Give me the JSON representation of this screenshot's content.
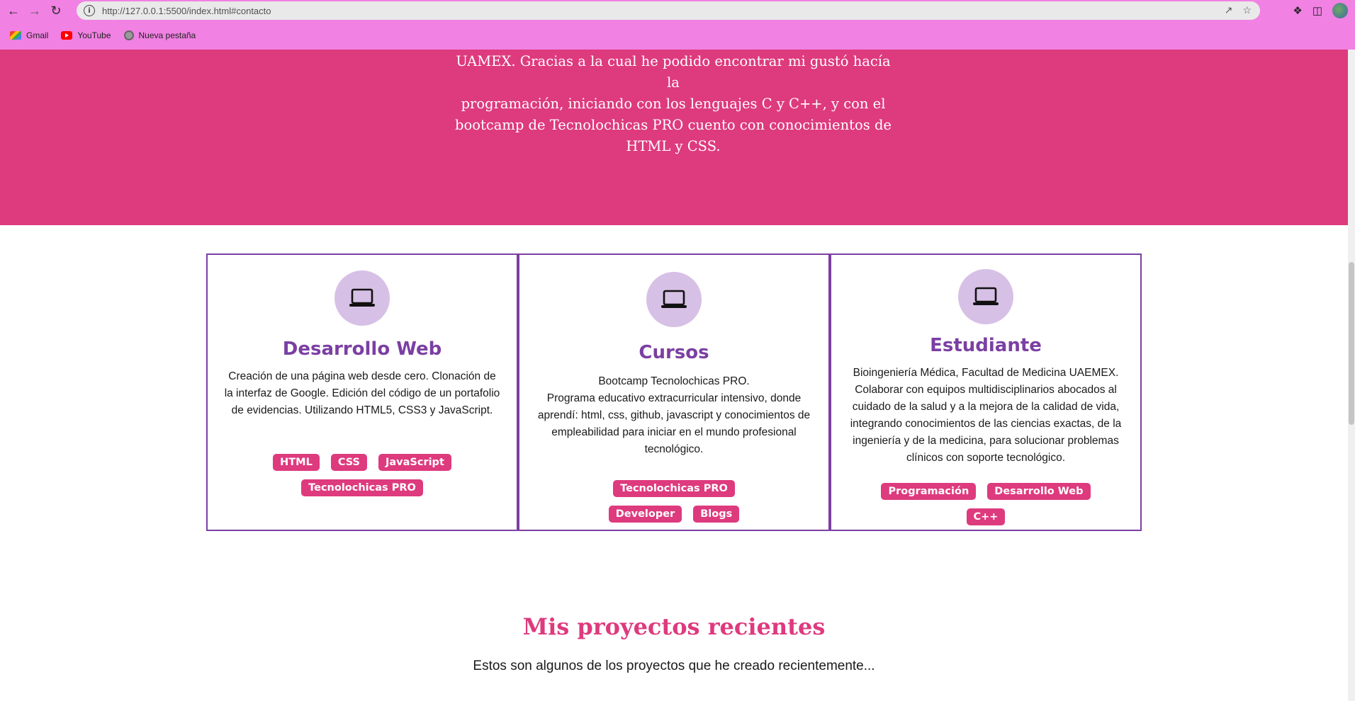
{
  "browser": {
    "url": "http://127.0.0.1:5500/index.html#contacto",
    "bookmarks": [
      {
        "label": "Gmail",
        "icon": "gmail-icon"
      },
      {
        "label": "YouTube",
        "icon": "youtube-icon"
      },
      {
        "label": "Nueva pestaña",
        "icon": "globe-icon"
      }
    ]
  },
  "hero": {
    "lines": [
      "UAMEX. Gracias a la cual he podido encontrar mi gustó hacía la",
      "programación, iniciando con los lenguajes C y C++, y con el",
      "bootcamp de Tecnolochicas PRO cuento con conocimientos de",
      "HTML y CSS."
    ]
  },
  "cards": [
    {
      "icon": "laptop-icon",
      "title": "Desarrollo Web",
      "description": "Creación de una página web desde cero. Clonación de la interfaz de Google. Edición del código de un portafolio de evidencias. Utilizando HTML5, CSS3 y JavaScript.",
      "tags": [
        "HTML",
        "CSS",
        "JavaScript",
        "Tecnolochicas PRO"
      ]
    },
    {
      "icon": "laptop-icon",
      "title": "Cursos",
      "description_line1": "Bootcamp Tecnolochicas PRO.",
      "description": "Programa educativo extracurricular intensivo, donde aprendí: html, css, github, javascript y conocimientos de empleabilidad para iniciar en el mundo profesional tecnológico.",
      "tags": [
        "Tecnolochicas PRO",
        "Developer",
        "Blogs"
      ]
    },
    {
      "icon": "laptop-icon",
      "title": "Estudiante",
      "description": "Bioingeniería Médica, Facultad de Medicina UAEMEX. Colaborar con equipos multidisciplinarios abocados al cuidado de la salud y a la mejora de la calidad de vida, integrando conocimientos de las ciencias exactas, de la ingeniería y de la medicina, para solucionar problemas clínicos con soporte tecnológico.",
      "tags": [
        "Programación",
        "Desarrollo Web",
        "C++"
      ]
    }
  ],
  "projects": {
    "title": "Mis proyectos recientes",
    "subtitle": "Estos son algunos de los proyectos que he creado recientemente..."
  },
  "colors": {
    "hero_bg": "#de3a7e",
    "chrome_bg": "#f181e3",
    "card_border": "#7b3fa3",
    "icon_circle": "#d7c0e6",
    "tag_bg": "#de3a7e"
  }
}
